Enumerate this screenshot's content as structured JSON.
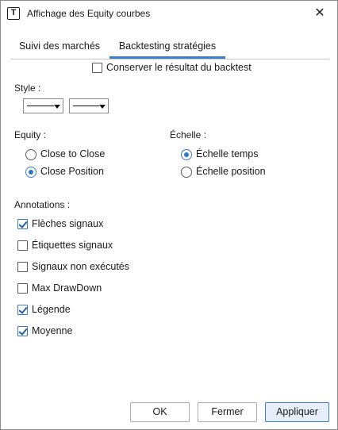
{
  "window": {
    "title": "Affichage des Equity courbes",
    "icon": "t-box-icon",
    "close_glyph": "✕"
  },
  "tabs": [
    {
      "label": "Suivi des marchés",
      "active": false
    },
    {
      "label": "Backtesting stratégies",
      "active": true
    }
  ],
  "keep_result": {
    "label": "Conserver le résultat du backtest",
    "checked": false
  },
  "style": {
    "label": "Style :"
  },
  "equity": {
    "label": "Equity :",
    "options": [
      {
        "label": "Close to Close",
        "checked": false
      },
      {
        "label": "Close Position",
        "checked": true
      }
    ]
  },
  "scale": {
    "label": "Échelle :",
    "options": [
      {
        "label": "Échelle temps",
        "checked": true
      },
      {
        "label": "Échelle position",
        "checked": false
      }
    ]
  },
  "annotations": {
    "label": "Annotations :",
    "items": [
      {
        "label": "Flèches signaux",
        "checked": true
      },
      {
        "label": "Étiquettes signaux",
        "checked": false
      },
      {
        "label": "Signaux non exécutés",
        "checked": false
      },
      {
        "label": "Max DrawDown",
        "checked": false
      },
      {
        "label": "Légende",
        "checked": true
      },
      {
        "label": "Moyenne",
        "checked": true
      }
    ]
  },
  "buttons": {
    "ok": "OK",
    "close": "Fermer",
    "apply": "Appliquer"
  },
  "colors": {
    "accent": "#3c7fc4",
    "primary_button_bg": "#e5eef9"
  }
}
